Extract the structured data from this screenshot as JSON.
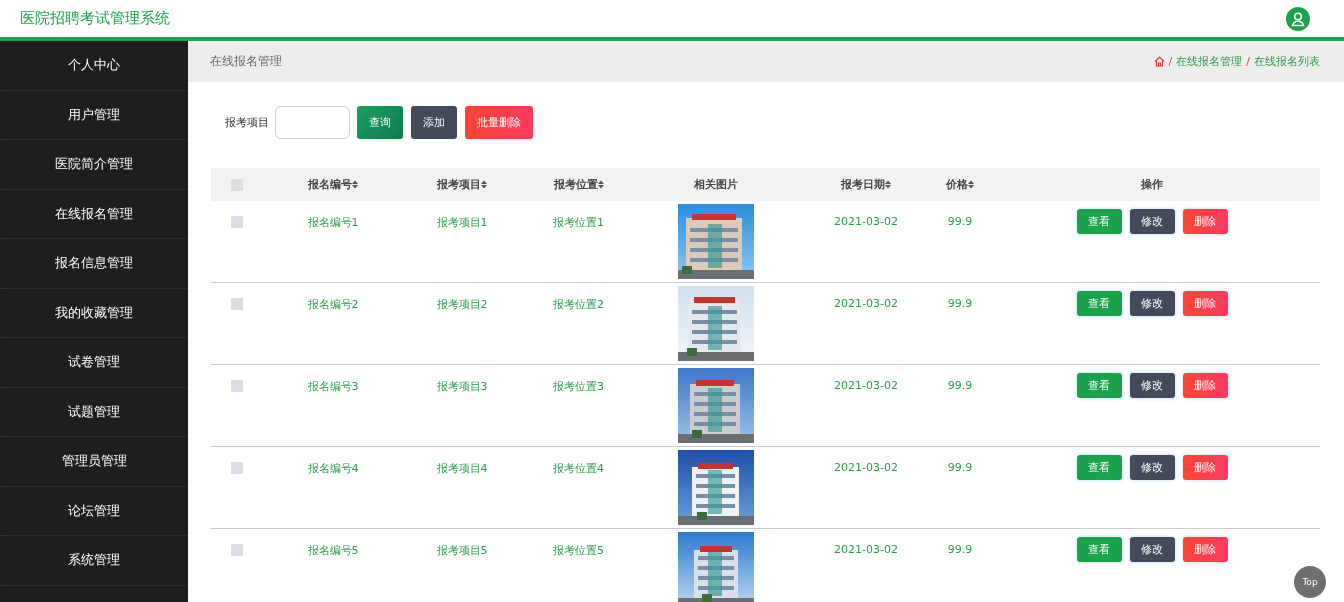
{
  "header": {
    "title": "医院招聘考试管理系统"
  },
  "sidebar": {
    "items": [
      {
        "label": "个人中心"
      },
      {
        "label": "用户管理"
      },
      {
        "label": "医院简介管理"
      },
      {
        "label": "在线报名管理"
      },
      {
        "label": "报名信息管理"
      },
      {
        "label": "我的收藏管理"
      },
      {
        "label": "试卷管理"
      },
      {
        "label": "试题管理"
      },
      {
        "label": "管理员管理"
      },
      {
        "label": "论坛管理"
      },
      {
        "label": "系统管理"
      }
    ]
  },
  "breadcrumb": {
    "title": "在线报名管理",
    "path": [
      {
        "kind": "separator",
        "text": "/"
      },
      {
        "kind": "link",
        "text": "在线报名管理"
      },
      {
        "kind": "separator",
        "text": "/"
      },
      {
        "kind": "link",
        "text": "在线报名列表"
      }
    ]
  },
  "search": {
    "label": "报考项目",
    "buttons": [
      {
        "label": "查询",
        "kind": "query"
      },
      {
        "label": "添加",
        "kind": "add"
      },
      {
        "label": "批量删除",
        "kind": "delete"
      }
    ]
  },
  "table": {
    "select_all": {
      "checked": false
    },
    "columns": [
      {
        "label": "报名编号",
        "sortable": true
      },
      {
        "label": "报考项目",
        "sortable": true
      },
      {
        "label": "报考位置",
        "sortable": true
      },
      {
        "label": "相关图片",
        "sortable": false
      },
      {
        "label": "报考日期",
        "sortable": true
      },
      {
        "label": "价格",
        "sortable": true
      },
      {
        "label": "操作",
        "sortable": false
      }
    ],
    "rows": [
      {
        "checked": false,
        "number": "报名编号1",
        "project": "报考项目1",
        "location": "报考位置1",
        "date": "2021-03-02",
        "price": "99.9",
        "actions": [
          {
            "label": "查看",
            "kind": "view"
          },
          {
            "label": "修改",
            "kind": "edit"
          },
          {
            "label": "删除",
            "kind": "delete"
          }
        ]
      },
      {
        "checked": false,
        "number": "报名编号2",
        "project": "报考项目2",
        "location": "报考位置2",
        "date": "2021-03-02",
        "price": "99.9",
        "actions": [
          {
            "label": "查看",
            "kind": "view"
          },
          {
            "label": "修改",
            "kind": "edit"
          },
          {
            "label": "删除",
            "kind": "delete"
          }
        ]
      },
      {
        "checked": false,
        "number": "报名编号3",
        "project": "报考项目3",
        "location": "报考位置3",
        "date": "2021-03-02",
        "price": "99.9",
        "actions": [
          {
            "label": "查看",
            "kind": "view"
          },
          {
            "label": "修改",
            "kind": "edit"
          },
          {
            "label": "删除",
            "kind": "delete"
          }
        ]
      },
      {
        "checked": false,
        "number": "报名编号4",
        "project": "报考项目4",
        "location": "报考位置4",
        "date": "2021-03-02",
        "price": "99.9",
        "actions": [
          {
            "label": "查看",
            "kind": "view"
          },
          {
            "label": "修改",
            "kind": "edit"
          },
          {
            "label": "删除",
            "kind": "delete"
          }
        ]
      },
      {
        "checked": false,
        "number": "报名编号5",
        "project": "报考项目5",
        "location": "报考位置5",
        "date": "2021-03-02",
        "price": "99.9",
        "actions": [
          {
            "label": "查看",
            "kind": "view"
          },
          {
            "label": "修改",
            "kind": "edit"
          },
          {
            "label": "删除",
            "kind": "delete"
          }
        ]
      }
    ]
  },
  "top_button": "Top"
}
